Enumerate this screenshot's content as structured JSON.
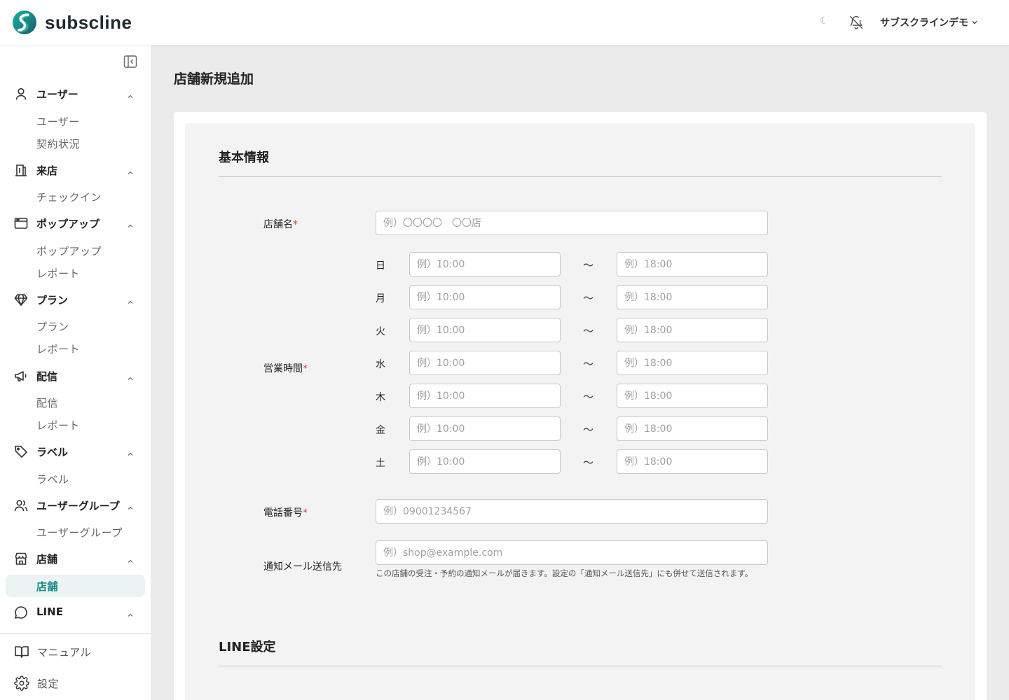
{
  "header": {
    "brand": "subscline",
    "theme_toggle_glyph": "☾",
    "account_name": "サブスクラインデモ"
  },
  "sidebar": {
    "groups": [
      {
        "label": "ユーザー",
        "icon": "user-icon",
        "items": [
          "ユーザー",
          "契約状況"
        ]
      },
      {
        "label": "来店",
        "icon": "building-icon",
        "items": [
          "チェックイン"
        ]
      },
      {
        "label": "ポップアップ",
        "icon": "window-icon",
        "items": [
          "ポップアップ",
          "レポート"
        ]
      },
      {
        "label": "プラン",
        "icon": "diamond-icon",
        "items": [
          "プラン",
          "レポート"
        ]
      },
      {
        "label": "配信",
        "icon": "megaphone-icon",
        "items": [
          "配信",
          "レポート"
        ]
      },
      {
        "label": "ラベル",
        "icon": "tag-icon",
        "items": [
          "ラベル"
        ]
      },
      {
        "label": "ユーザーグループ",
        "icon": "users-icon",
        "items": [
          "ユーザーグループ"
        ]
      },
      {
        "label": "店舗",
        "icon": "store-icon",
        "items": [
          "店舗"
        ]
      },
      {
        "label": "LINE",
        "icon": "chat-icon",
        "items": []
      }
    ],
    "active_item": "店舗",
    "footer": [
      {
        "label": "マニュアル",
        "icon": "book-icon"
      },
      {
        "label": "設定",
        "icon": "gear-icon"
      }
    ]
  },
  "page": {
    "title": "店舗新規追加",
    "sections": {
      "basic": "基本情報",
      "line": "LINE設定"
    },
    "form": {
      "store_name": {
        "label": "店舗名",
        "required_mark": "*",
        "placeholder": "例）〇〇〇〇　〇〇店"
      },
      "hours": {
        "label": "営業時間",
        "required_mark": "*",
        "separator": "〜",
        "open_placeholder": "例）10:00",
        "close_placeholder": "例）18:00",
        "days": [
          "日",
          "月",
          "火",
          "水",
          "木",
          "金",
          "土"
        ]
      },
      "phone": {
        "label": "電話番号",
        "required_mark": "*",
        "placeholder": "例）09001234567"
      },
      "email": {
        "label": "通知メール送信先",
        "placeholder": "例）shop@example.com",
        "help": "この店舗の受注・予約の通知メールが届きます。設定の「通知メール送信先」にも併せて送信されます。"
      }
    }
  },
  "colors": {
    "accent": "#1b8a86",
    "active_bg": "#eaf4f3",
    "required": "#e23c3c"
  }
}
